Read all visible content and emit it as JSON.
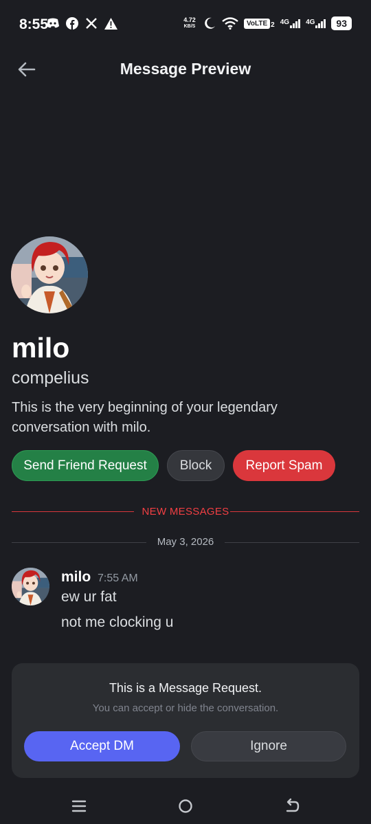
{
  "status_bar": {
    "time": "8:55",
    "left_icons": [
      "discord-icon",
      "facebook-icon",
      "x-icon",
      "warning-icon"
    ],
    "net_speed_value": "4.72",
    "net_speed_unit": "KB/S",
    "volte": "VoLTE",
    "volte_sim": "2",
    "sig1_label": "4G",
    "sig2_label": "4G",
    "battery": "93"
  },
  "header": {
    "title": "Message Preview",
    "back_icon": "arrow-left-icon"
  },
  "profile": {
    "display_name": "milo",
    "username": "compelius",
    "intro": "This is the very beginning of your legendary conversation with milo.",
    "buttons": {
      "send_friend_request": "Send Friend Request",
      "block": "Block",
      "report_spam": "Report Spam"
    }
  },
  "dividers": {
    "new_messages": "NEW MESSAGES",
    "date": "May 3, 2026"
  },
  "message": {
    "author": "milo",
    "time": "7:55 AM",
    "lines": [
      "ew ur fat",
      "not me clocking u"
    ]
  },
  "request_card": {
    "title": "This is a Message Request.",
    "subtitle": "You can accept or hide the conversation.",
    "accept": "Accept DM",
    "ignore": "Ignore"
  },
  "colors": {
    "background": "#1c1d22",
    "green": "#248046",
    "red": "#da373c",
    "blurple": "#5865f2"
  },
  "nav": [
    "menu-icon",
    "home-icon",
    "back-icon"
  ]
}
